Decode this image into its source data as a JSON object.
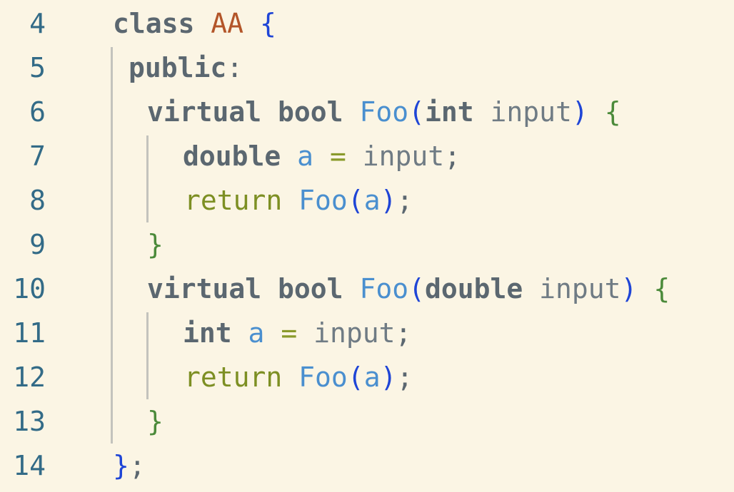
{
  "editor": {
    "lines": [
      {
        "num": "4",
        "tokens": [
          {
            "t": "class",
            "c": "kw"
          },
          {
            "t": " ",
            "c": "id"
          },
          {
            "t": "AA",
            "c": "cls"
          },
          {
            "t": " ",
            "c": "id"
          },
          {
            "t": "{",
            "c": "brace"
          }
        ]
      },
      {
        "num": "5",
        "tokens": [
          {
            "t": "public",
            "c": "kw"
          },
          {
            "t": ":",
            "c": "punct"
          }
        ]
      },
      {
        "num": "6",
        "tokens": [
          {
            "t": "virtual",
            "c": "kw"
          },
          {
            "t": " ",
            "c": "id"
          },
          {
            "t": "bool",
            "c": "kw"
          },
          {
            "t": " ",
            "c": "id"
          },
          {
            "t": "Foo",
            "c": "fn"
          },
          {
            "t": "(",
            "c": "brace"
          },
          {
            "t": "int",
            "c": "kw"
          },
          {
            "t": " ",
            "c": "id"
          },
          {
            "t": "input",
            "c": "id"
          },
          {
            "t": ")",
            "c": "brace"
          },
          {
            "t": " ",
            "c": "id"
          },
          {
            "t": "{",
            "c": "blk"
          }
        ]
      },
      {
        "num": "7",
        "tokens": [
          {
            "t": "double",
            "c": "kw"
          },
          {
            "t": " ",
            "c": "id"
          },
          {
            "t": "a",
            "c": "var"
          },
          {
            "t": " ",
            "c": "id"
          },
          {
            "t": "=",
            "c": "op"
          },
          {
            "t": " ",
            "c": "id"
          },
          {
            "t": "input",
            "c": "id"
          },
          {
            "t": ";",
            "c": "punct"
          }
        ]
      },
      {
        "num": "8",
        "tokens": [
          {
            "t": "return",
            "c": "ret"
          },
          {
            "t": " ",
            "c": "id"
          },
          {
            "t": "Foo",
            "c": "fn"
          },
          {
            "t": "(",
            "c": "brace"
          },
          {
            "t": "a",
            "c": "var"
          },
          {
            "t": ")",
            "c": "brace"
          },
          {
            "t": ";",
            "c": "punct"
          }
        ]
      },
      {
        "num": "9",
        "tokens": [
          {
            "t": "}",
            "c": "blk"
          }
        ]
      },
      {
        "num": "10",
        "tokens": [
          {
            "t": "virtual",
            "c": "kw"
          },
          {
            "t": " ",
            "c": "id"
          },
          {
            "t": "bool",
            "c": "kw"
          },
          {
            "t": " ",
            "c": "id"
          },
          {
            "t": "Foo",
            "c": "fn"
          },
          {
            "t": "(",
            "c": "brace"
          },
          {
            "t": "double",
            "c": "kw"
          },
          {
            "t": " ",
            "c": "id"
          },
          {
            "t": "input",
            "c": "id"
          },
          {
            "t": ")",
            "c": "brace"
          },
          {
            "t": " ",
            "c": "id"
          },
          {
            "t": "{",
            "c": "blk"
          }
        ]
      },
      {
        "num": "11",
        "tokens": [
          {
            "t": "int",
            "c": "kw"
          },
          {
            "t": " ",
            "c": "id"
          },
          {
            "t": "a",
            "c": "var"
          },
          {
            "t": " ",
            "c": "id"
          },
          {
            "t": "=",
            "c": "op"
          },
          {
            "t": " ",
            "c": "id"
          },
          {
            "t": "input",
            "c": "id"
          },
          {
            "t": ";",
            "c": "punct"
          }
        ]
      },
      {
        "num": "12",
        "tokens": [
          {
            "t": "return",
            "c": "ret"
          },
          {
            "t": " ",
            "c": "id"
          },
          {
            "t": "Foo",
            "c": "fn"
          },
          {
            "t": "(",
            "c": "brace"
          },
          {
            "t": "a",
            "c": "var"
          },
          {
            "t": ")",
            "c": "brace"
          },
          {
            "t": ";",
            "c": "punct"
          }
        ]
      },
      {
        "num": "13",
        "tokens": [
          {
            "t": "}",
            "c": "blk"
          }
        ]
      },
      {
        "num": "14",
        "tokens": [
          {
            "t": "}",
            "c": "brace"
          },
          {
            "t": ";",
            "c": "punct"
          }
        ]
      }
    ]
  },
  "colors": {
    "background": "#fbf5e4",
    "line_number": "#336b87",
    "keyword": "#5b6770",
    "class_name": "#b35529",
    "brace": "#1f45d6",
    "block_brace": "#4b8a3a",
    "function": "#4a8fcf",
    "identifier": "#6f7b84",
    "operator": "#8a9a2a",
    "return_keyword": "#7d8f23",
    "indent_guide": "#c3c3bd"
  }
}
